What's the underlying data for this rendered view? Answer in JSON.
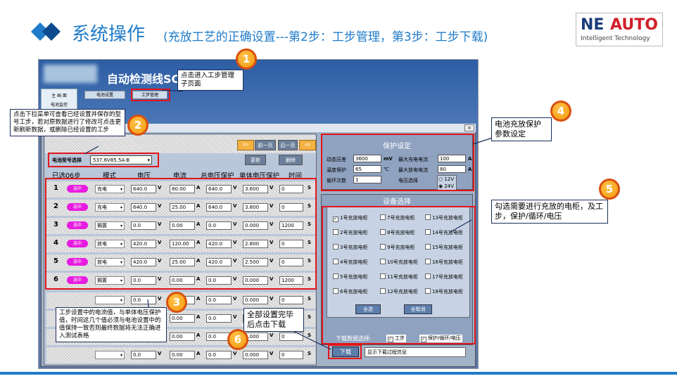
{
  "slide": {
    "title": "系统操作",
    "subtitle": "(充放工艺的正确设置---第2步：工步管理，第3步：工步下载)",
    "logo_ne": "NE",
    "logo_auto": "AUTO",
    "logo_tagline": "Intelligent Technology",
    "accent_color": "#1f7bc9",
    "highlight_color": "#e3151a"
  },
  "background_app": {
    "title": "自动检测线SC/",
    "sidebar_items": [
      "主 画 面",
      "电池监控"
    ],
    "tabs": [
      "电池设置",
      "工步管理"
    ]
  },
  "dialog": {
    "close_label": "×",
    "prev_page": "前一页",
    "next_page": "后一页",
    "update_label": "更新",
    "delete_label": "删除",
    "model_label": "电池型号选择",
    "model_value": "537.6V85.5A-B",
    "columns": {
      "selected": "已选06步",
      "mode": "模式",
      "voltage": "电压",
      "current": "电流",
      "total_protect": "总电压保护",
      "cell_protect": "单体电压保护",
      "time": "时间"
    },
    "units": {
      "v": "V",
      "a": "A",
      "s": "S"
    },
    "select_label": "选中",
    "steps": [
      {
        "no": "1",
        "mode": "充电",
        "voltage": "640.0",
        "current": "80.00",
        "total": "640.0",
        "cell": "3.600",
        "time": "0"
      },
      {
        "no": "2",
        "mode": "充电",
        "voltage": "640.0",
        "current": "25.00",
        "total": "640.0",
        "cell": "3.800",
        "time": "0"
      },
      {
        "no": "3",
        "mode": "搁置",
        "voltage": "0.0",
        "current": "0.00",
        "total": "0.0",
        "cell": "0.000",
        "time": "1200"
      },
      {
        "no": "4",
        "mode": "放电",
        "voltage": "420.0",
        "current": "120.00",
        "total": "420.0",
        "cell": "2.800",
        "time": "0"
      },
      {
        "no": "5",
        "mode": "放电",
        "voltage": "420.0",
        "current": "25.00",
        "total": "420.0",
        "cell": "2.500",
        "time": "0"
      },
      {
        "no": "6",
        "mode": "搁置",
        "voltage": "0.0",
        "current": "0.00",
        "total": "0.0",
        "cell": "0.000",
        "time": "1200"
      }
    ],
    "empty_rows": [
      {
        "voltage": "0.0",
        "current": "0.00",
        "total": "0.0",
        "cell": "0.000",
        "time": "0"
      },
      {
        "voltage": "0.0",
        "current": "0.00",
        "total": "0.0",
        "cell": "0.000",
        "time": "0"
      },
      {
        "voltage": "0.0",
        "current": "0.00",
        "total": "0.0",
        "cell": "0.000",
        "time": "0"
      },
      {
        "voltage": "0.0",
        "current": "0.00",
        "total": "0.0",
        "cell": "0.000",
        "time": "0"
      }
    ],
    "protection": {
      "title": "保护设定",
      "dynamic_diff_label": "动态压差",
      "dynamic_diff_value": "3600",
      "dynamic_diff_unit": "mV",
      "temp_label": "温度保护",
      "temp_value": "65",
      "temp_unit": "℃",
      "cycles_label": "循环次数",
      "cycles_value": "1",
      "max_charge_label": "最大充电电流",
      "max_charge_value": "100",
      "max_discharge_label": "最大放电电流",
      "max_discharge_value": "80",
      "current_unit": "A",
      "voltage_select_label": "电压选择",
      "voltage_options": [
        "12V",
        "24V"
      ]
    },
    "equipment": {
      "title": "设备选择",
      "cabinets": [
        [
          "1号充放电柜",
          "7号充放电柜",
          "13号充放电柜"
        ],
        [
          "2号充放电柜",
          "8号充放电柜",
          "14号充放电柜"
        ],
        [
          "3号充放电柜",
          "9号充放电柜",
          "15号充放电柜"
        ],
        [
          "4号充放电柜",
          "10号充放电柜",
          "16号充放电柜"
        ],
        [
          "5号充放电柜",
          "11号充放电柜",
          "17号充放电柜"
        ],
        [
          "6号充放电柜",
          "12号充放电柜",
          "18号充放电柜"
        ]
      ],
      "select_all": "全选",
      "deselect_all": "全取消"
    },
    "download": {
      "data_select_label": "下载数据选择:",
      "step_option": "工步",
      "protect_option": "保护/循环/电压",
      "button": "下载",
      "info": "显示下载过程信息"
    }
  },
  "callouts": {
    "c1": "点击进入工步管理子页面",
    "c2": "点击下拉菜单可查看已经设置并保存的型号工步，若对原数据进行了修改可点击更新刷新数据，或删除已经设置的工步",
    "c3": "工步设置中的电流值，与单体电压保护值，时间这几个值必须与电池设置中的值保持一致否则最终数据将无法正确进入测试表格",
    "c4": "电池充放保护参数设定",
    "c5": "勾选需要进行充放的电柜，及工步，保护/循环/电压",
    "c6": "全部设置完毕后点击下载"
  },
  "badges": [
    "1",
    "2",
    "3",
    "4",
    "5",
    "6"
  ]
}
